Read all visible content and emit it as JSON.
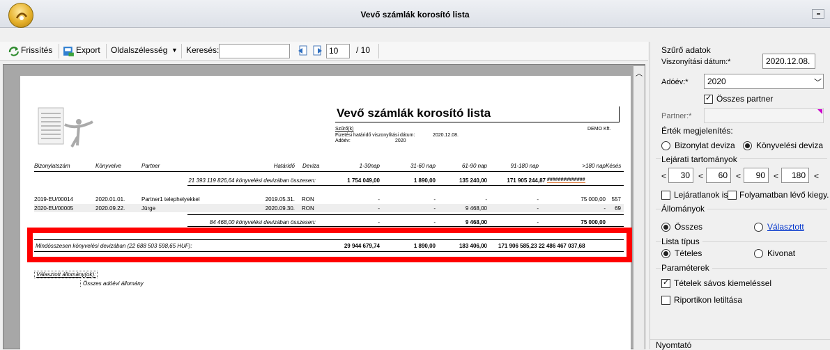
{
  "window": {
    "title": "Vevő számlák korosító lista"
  },
  "toolbar": {
    "refresh": "Frissítés",
    "export": "Export",
    "zoom": "Oldalszélesség",
    "search_label": "Keresés:",
    "search_value": "",
    "page_current": "10",
    "page_total": "/ 10"
  },
  "report": {
    "title": "Vevő számlák korosító lista",
    "filters_link": "Szűrő(k)",
    "company": "DEMO Kft.",
    "date_label": "Fizetési határidő viszonylítási dátum:",
    "date_value": "2020.12.08.",
    "year_label": "Adóév:",
    "year_value": "2020",
    "columns": [
      "Bizonylatszám",
      "Könyvelve",
      "Partner",
      "Határidő",
      "Deviza",
      "1-30nap",
      "31-60 nap",
      "61-90 nap",
      "91-180 nap",
      ">180 nap",
      "Késés"
    ],
    "group_total": {
      "text": "21 393 119 826,64 könyvelési devizában összesen:",
      "c1": "1 754 049,00",
      "c2": "1 890,00",
      "c3": "135 240,00",
      "c4": "171 905 244,87",
      "c5": "##############"
    },
    "rows": [
      {
        "num": "2019-EU/00014",
        "booked": "2020.01.01.",
        "partner": "Partner1 telephelyekkel",
        "due": "2019.05.31.",
        "cur": "RON",
        "c1": "-",
        "c2": "-",
        "c3": "-",
        "c4": "-",
        "c5": "75 000,00",
        "late": "557"
      },
      {
        "num": "2020-EU/00005",
        "booked": "2020.09.22.",
        "partner": "Jürge",
        "due": "2020.09.30.",
        "cur": "RON",
        "c1": "-",
        "c2": "-",
        "c3": "9 468,00",
        "c4": "-",
        "c5": "-",
        "late": "69"
      }
    ],
    "sub_total": {
      "text": "84 468,00 könyvelési devizában összesen:",
      "c1": "-",
      "c2": "-",
      "c3": "9 468,00",
      "c4": "-",
      "c5": "75 000,00"
    },
    "grand_total": {
      "text": "Mindösszesen könyvelési devizában (22 688 503 598,65 HUF):",
      "c1": "29 944 679,74",
      "c2": "1 890,00",
      "c3": "183 406,00",
      "c4c5": "171 906 585,23 22 486 467 037,68"
    },
    "selected_label": "Választott állomány(ok):",
    "selected_value": "Összes adóévi állomány"
  },
  "panel": {
    "group_filter": "Szűrő adatok",
    "ref_date_label": "Viszonyítási dátum:*",
    "ref_date_value": "2020.12.08.",
    "year_label": "Adóév:*",
    "year_value": "2020",
    "all_partner": "Összes partner",
    "partner_label": "Partner:*",
    "value_display": "Érték megjelenítés:",
    "doc_currency": "Bizonylat deviza",
    "book_currency": "Könyvelési deviza",
    "ranges_label": "Lejárati tartományok",
    "range1": "30",
    "range2": "60",
    "range3": "90",
    "range4": "180",
    "lt": "<",
    "overdue": "Lejáratlanok is",
    "ongoing": "Folyamatban lévő kiegy. is",
    "states_label": "Állományok",
    "all_states": "Összes",
    "selected_states": "Választott",
    "list_type_label": "Lista típus",
    "itemized": "Tételes",
    "extract": "Kivonat",
    "params_label": "Paraméterek",
    "striped": "Tételek sávos kiemeléssel",
    "disable_report": "Riportikon letiltása",
    "printer": "Nyomtató"
  },
  "colors": {
    "highlight": "#ff0000",
    "link": "#0033cc",
    "accent": "#cc00cc"
  }
}
